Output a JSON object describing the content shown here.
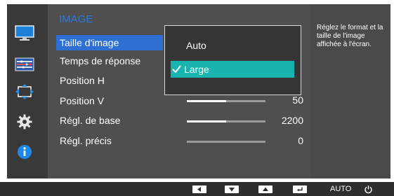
{
  "sidebar": {
    "icons": [
      "monitor-icon",
      "color-icon",
      "resize-icon",
      "gear-icon",
      "info-icon"
    ],
    "colors": {
      "accent": "#2f78d8"
    }
  },
  "menu": {
    "title": "IMAGE",
    "items": [
      {
        "label": "Taille d'image"
      },
      {
        "label": "Temps de réponse"
      },
      {
        "label": "Position H"
      },
      {
        "label": "Position V",
        "value": "50",
        "level": 0.5
      },
      {
        "label": "Régl. de base",
        "value": "2200",
        "level": 0.5
      },
      {
        "label": "Régl. précis",
        "value": "0",
        "level": 0.0
      }
    ]
  },
  "submenu": {
    "options": [
      {
        "label": "Auto"
      },
      {
        "label": "Large"
      }
    ],
    "selected": "Large",
    "selected_color": "#19b3b0"
  },
  "help": {
    "text": "Réglez le format et la taille de l'image affichée à l'écran."
  },
  "bottom_bar": {
    "buttons": [
      {
        "icon": "left-arrow-icon"
      },
      {
        "icon": "down-arrow-icon"
      },
      {
        "icon": "up-arrow-icon"
      },
      {
        "icon": "enter-icon"
      },
      {
        "label": "AUTO"
      },
      {
        "icon": "power-icon"
      }
    ]
  }
}
